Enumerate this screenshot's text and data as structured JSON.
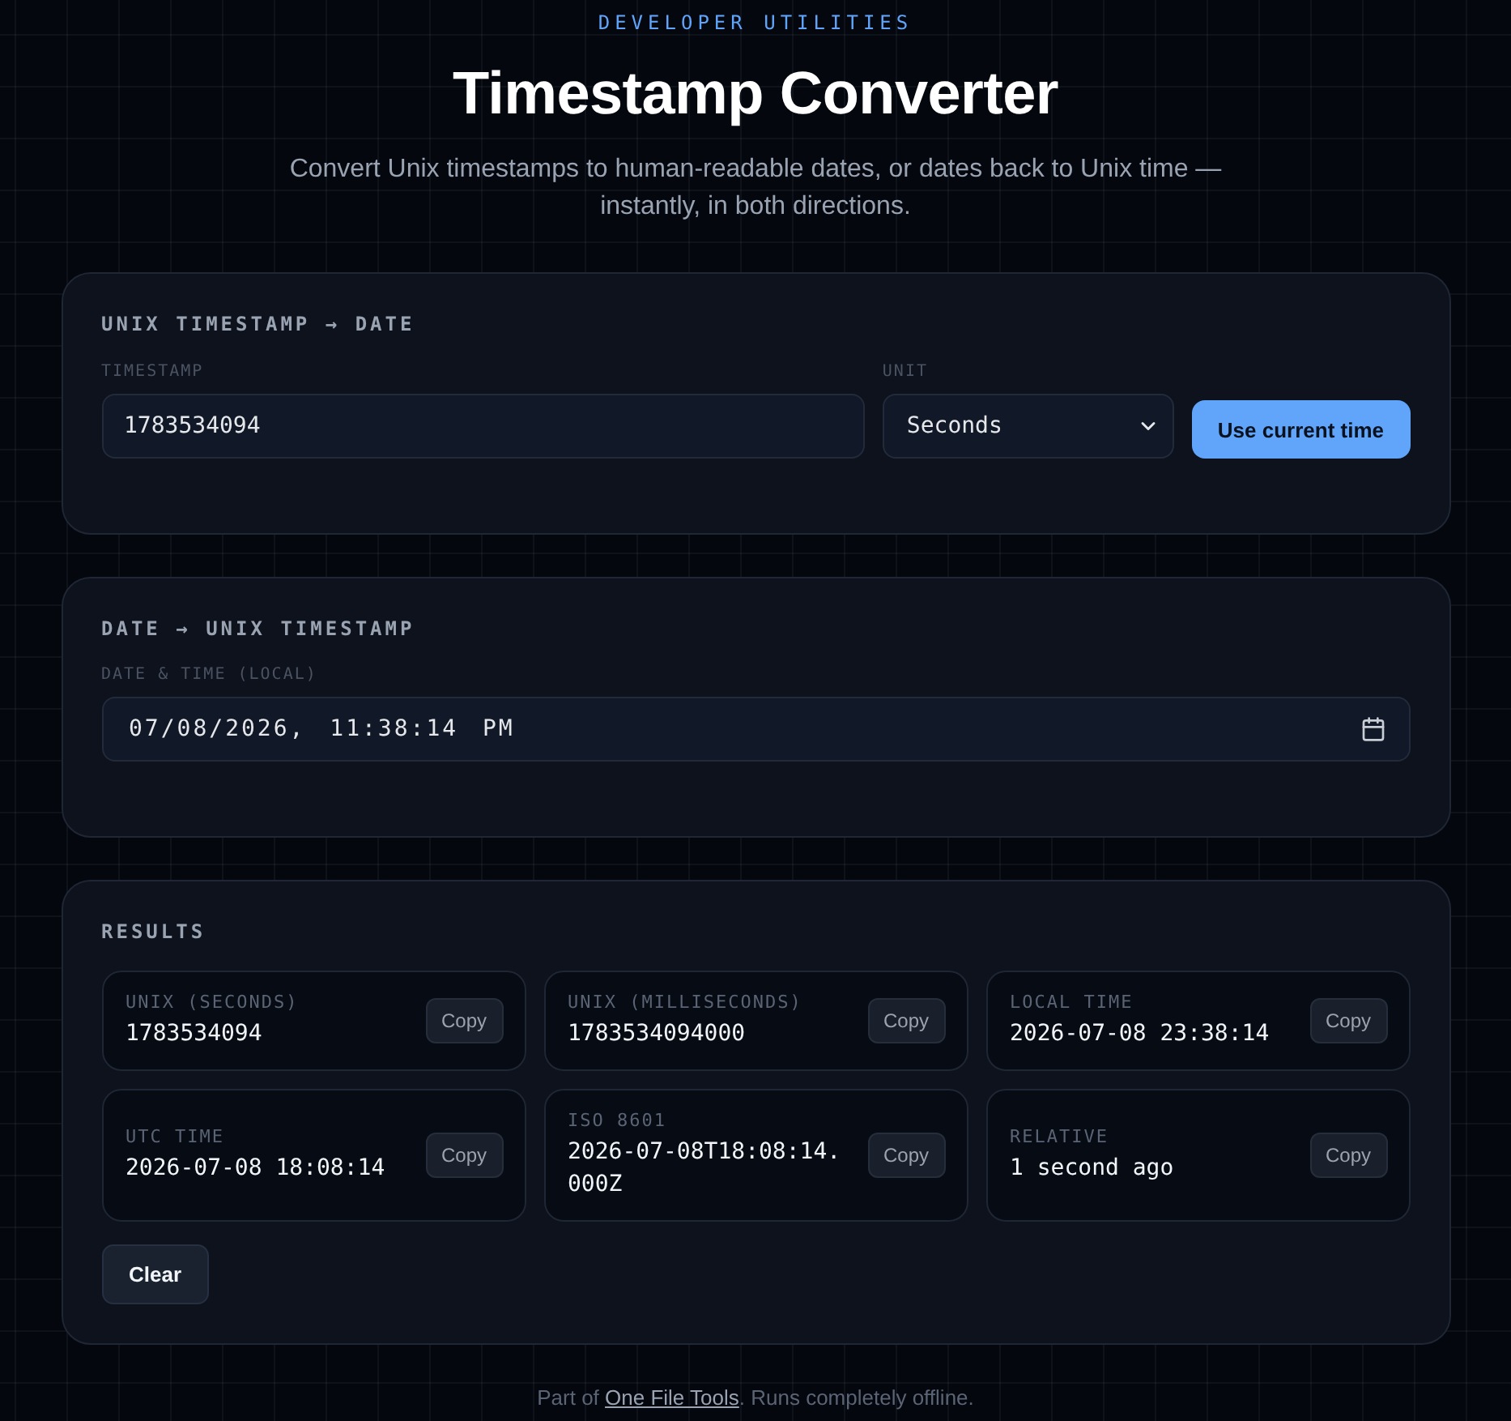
{
  "header": {
    "eyebrow": "DEVELOPER UTILITIES",
    "title": "Timestamp Converter",
    "subtitle": "Convert Unix timestamps to human-readable dates, or dates back to Unix time — instantly, in both directions."
  },
  "unix_to_date": {
    "title": "UNIX TIMESTAMP → DATE",
    "timestamp": {
      "label": "TIMESTAMP",
      "value": "1783534094"
    },
    "unit": {
      "label": "UNIT",
      "value": "Seconds"
    },
    "button": "Use current time"
  },
  "date_to_unix": {
    "title": "DATE → UNIX TIMESTAMP",
    "datetime": {
      "label": "DATE & TIME (LOCAL)",
      "value": "07/08/2026, 11:38:14 PM"
    }
  },
  "results": {
    "title": "RESULTS",
    "items": [
      {
        "label": "UNIX (SECONDS)",
        "value": "1783534094",
        "button": "Copy"
      },
      {
        "label": "UNIX (MILLISECONDS)",
        "value": "1783534094000",
        "button": "Copy"
      },
      {
        "label": "LOCAL TIME",
        "value": "2026-07-08 23:38:14",
        "button": "Copy"
      },
      {
        "label": "UTC TIME",
        "value": "2026-07-08 18:08:14",
        "button": "Copy"
      },
      {
        "label": "ISO 8601",
        "value": "2026-07-08T18:08:14.000Z",
        "button": "Copy"
      },
      {
        "label": "RELATIVE",
        "value": "1 second ago",
        "button": "Copy"
      }
    ],
    "clear_button": "Clear"
  },
  "footer": {
    "prefix": "Part of ",
    "link": "One File Tools",
    "suffix": ". Runs completely offline."
  }
}
